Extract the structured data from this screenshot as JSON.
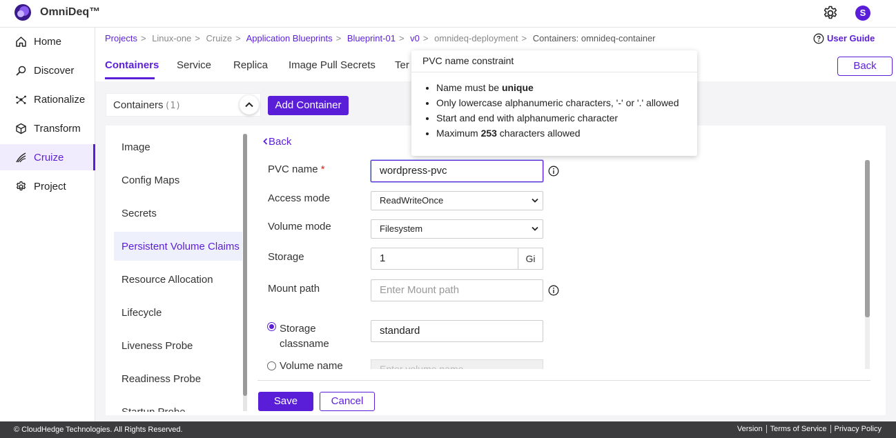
{
  "app": {
    "name": "OmniDeq™",
    "user_initial": "S"
  },
  "sidebar": {
    "items": [
      {
        "label": "Home",
        "icon": "home-icon"
      },
      {
        "label": "Discover",
        "icon": "discover-icon"
      },
      {
        "label": "Rationalize",
        "icon": "rationalize-icon"
      },
      {
        "label": "Transform",
        "icon": "transform-icon"
      },
      {
        "label": "Cruize",
        "icon": "cruize-icon",
        "active": true
      },
      {
        "label": "Project",
        "icon": "project-icon"
      }
    ]
  },
  "breadcrumb": {
    "items": [
      "Projects",
      "Linux-one",
      "Cruize",
      "Application Blueprints",
      "Blueprint-01",
      "v0",
      "omnideq-deployment",
      "Containers: omnideq-container"
    ],
    "separator": ">"
  },
  "user_guide": "User Guide",
  "tabs": [
    "Containers",
    "Service",
    "Replica",
    "Image Pull Secrets",
    "Ter"
  ],
  "back_button": "Back",
  "containers": {
    "label": "Containers",
    "count": "(1)",
    "add_button": "Add Container"
  },
  "left_menu": [
    "Image",
    "Config Maps",
    "Secrets",
    "Persistent Volume Claims",
    "Resource Allocation",
    "Lifecycle",
    "Liveness Probe",
    "Readiness Probe",
    "Startup Probe"
  ],
  "form": {
    "back_link": "Back",
    "pvc_name_label": "PVC name",
    "required_mark": "*",
    "pvc_name_value": "wordpress-pvc",
    "access_mode_label": "Access mode",
    "access_mode_value": "ReadWriteOnce",
    "volume_mode_label": "Volume mode",
    "volume_mode_value": "Filesystem",
    "storage_label": "Storage",
    "storage_value": "1",
    "storage_unit": "Gi",
    "mount_path_label": "Mount path",
    "mount_path_placeholder": "Enter Mount path",
    "storage_class_label_1": "Storage",
    "storage_class_label_2": "classname",
    "storage_class_value": "standard",
    "volume_name_label": "Volume name",
    "volume_name_placeholder": "Enter volume name",
    "save": "Save",
    "cancel": "Cancel"
  },
  "tooltip": {
    "title": "PVC name constraint",
    "line1_pre": "Name must be ",
    "line1_bold": "unique",
    "line2": "Only lowercase alphanumeric characters, '-' or '.' allowed",
    "line3": "Start and end with alphanumeric character",
    "line4_pre": "Maximum ",
    "line4_bold": "253",
    "line4_post": " characters allowed"
  },
  "footer": {
    "copyright": "© CloudHedge Technologies. All Rights Reserved.",
    "links": [
      "Version",
      "Terms of Service",
      "Privacy Policy"
    ]
  },
  "colors": {
    "accent": "#5b1ed8",
    "footer_bg": "#3c3b3d",
    "required": "#d9261c"
  }
}
